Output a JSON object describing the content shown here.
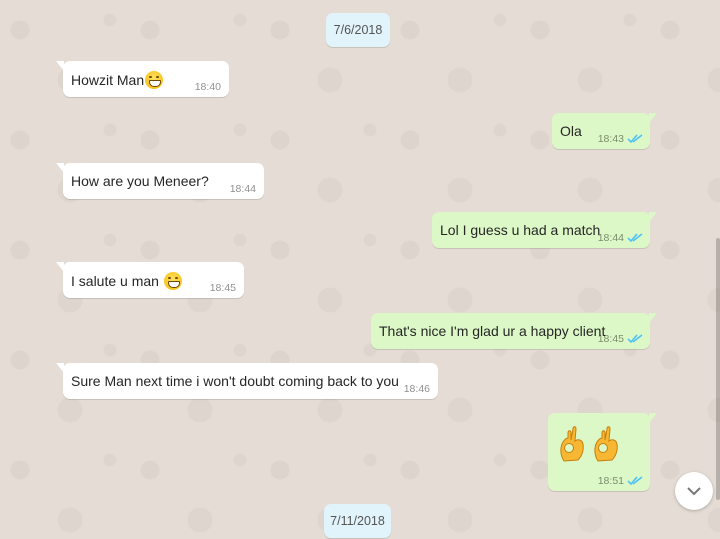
{
  "conversation": {
    "date_top": "7/6/2018",
    "date_bottom": "7/11/2018",
    "messages": [
      {
        "direction": "incoming",
        "text": "Howzit Man",
        "emoji": "grinning-face",
        "time": "18:40"
      },
      {
        "direction": "outgoing",
        "text": "Ola",
        "time": "18:43",
        "status": "read"
      },
      {
        "direction": "incoming",
        "text": "How are you Meneer?",
        "time": "18:44"
      },
      {
        "direction": "outgoing",
        "text": "Lol I guess u had a match",
        "time": "18:44",
        "status": "read"
      },
      {
        "direction": "incoming",
        "text": "I salute u man ",
        "emoji": "grinning-face",
        "time": "18:45"
      },
      {
        "direction": "outgoing",
        "text": "That's nice I'm glad ur a happy client",
        "time": "18:45",
        "status": "read"
      },
      {
        "direction": "incoming",
        "text": "Sure Man next time i won't doubt coming back to you",
        "time": "18:46"
      },
      {
        "direction": "outgoing",
        "text": "",
        "emoji": "ok-hand x2",
        "time": "18:51",
        "status": "read"
      }
    ]
  },
  "colors": {
    "background": "#e5ddd5",
    "incoming_bubble": "#ffffff",
    "outgoing_bubble": "#dcf8c6",
    "date_chip": "#e1f3fb",
    "read_ticks": "#4fc3f7"
  },
  "icons": {
    "read_status": "double-check-icon",
    "scroll_down": "chevron-down-icon"
  }
}
